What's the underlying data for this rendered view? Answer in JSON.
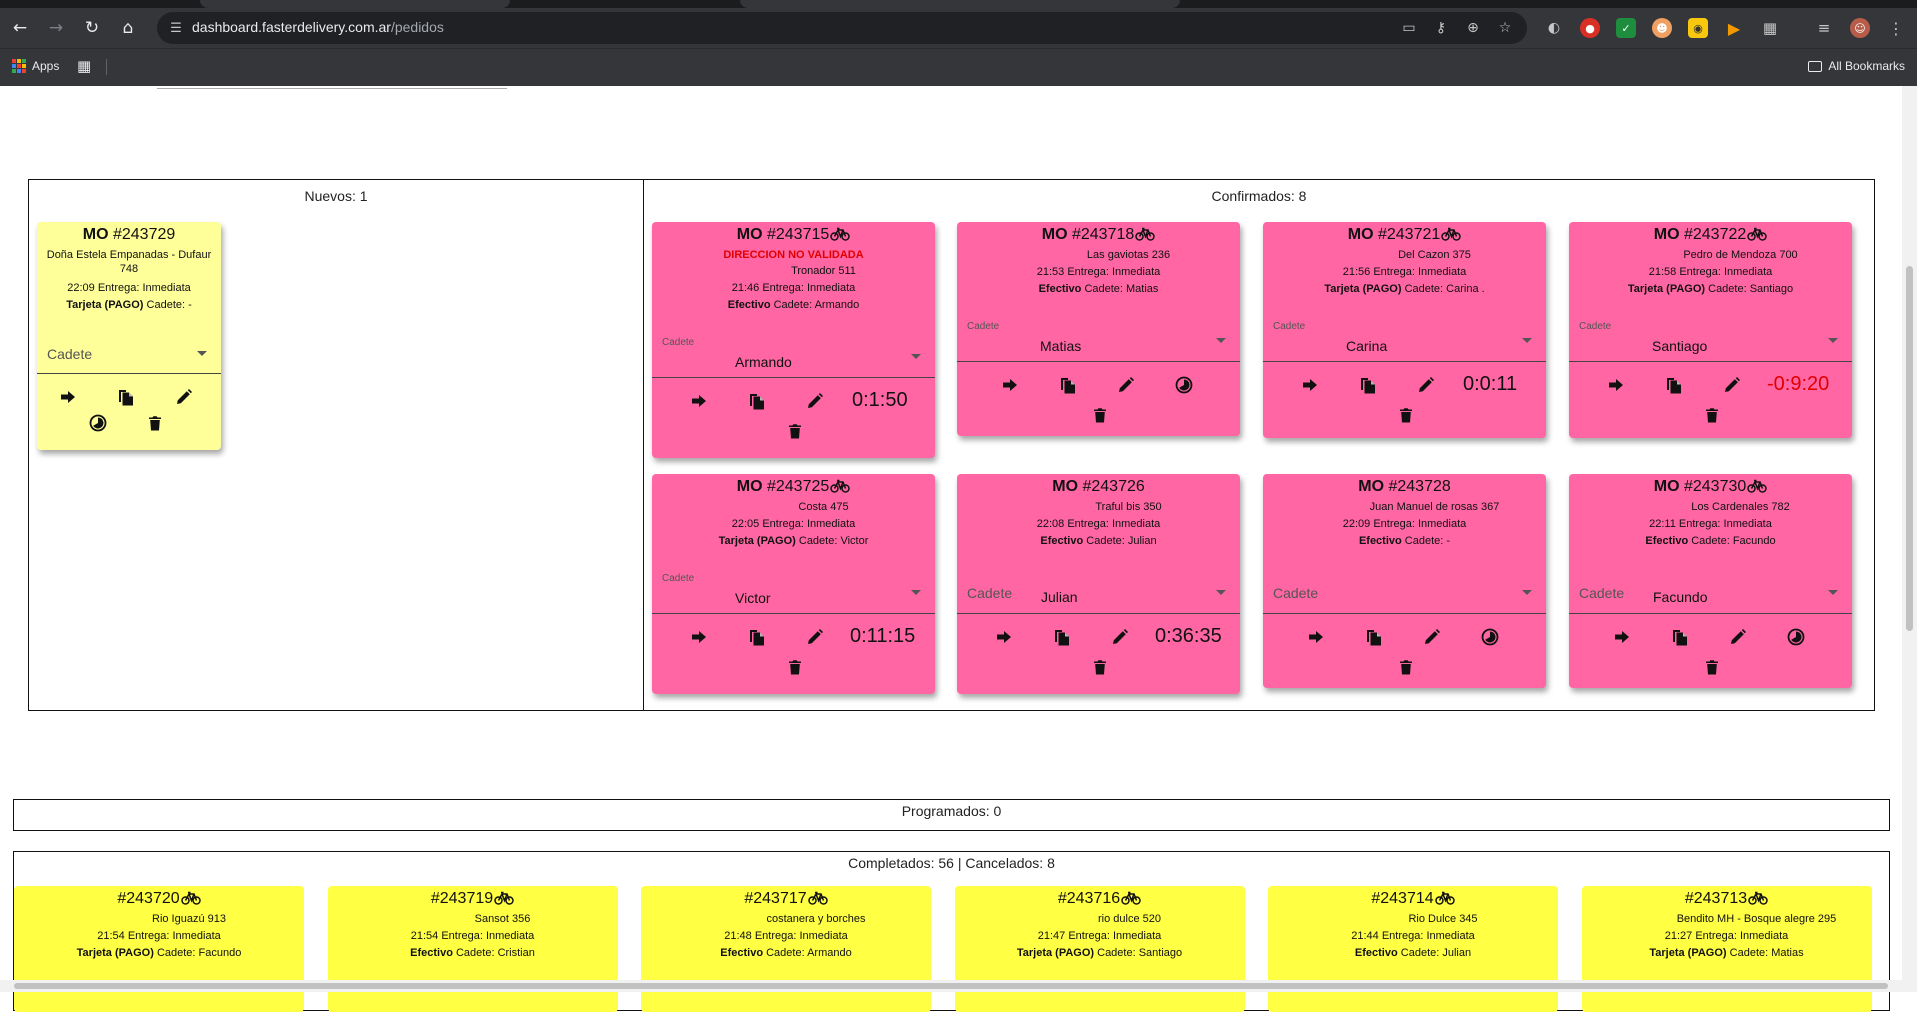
{
  "browser": {
    "url_domain": "dashboard.fasterdelivery.com.ar",
    "url_path": "/pedidos",
    "bookmarks": {
      "apps_label": "Apps",
      "all_bookmarks_label": "All Bookmarks"
    }
  },
  "colors": {
    "nuevo_card": "#ffff99",
    "confirmado_card": "#ff66a3",
    "completado_card": "#ffff44",
    "warning": "#e00000"
  },
  "icons": {
    "forward": "arrow-right-icon",
    "copy": "copy-icon",
    "edit": "pencil-icon",
    "schedule": "timer-icon",
    "delete": "trash-icon",
    "delivery": "bicycle-icon"
  },
  "nuevos": {
    "title": "Nuevos: 1",
    "cards": [
      {
        "prefix": "MO",
        "number": "#243729",
        "business": "Doña Estela Empanadas - Dufaur",
        "business2": "748",
        "time_line": "22:09 Entrega: Inmediata",
        "payment": "Tarjeta (PAGO)",
        "cadete_line": "Cadete: -",
        "select_placeholder": "Cadete"
      }
    ]
  },
  "confirmados": {
    "title": "Confirmados: 8",
    "cards": [
      {
        "prefix": "MO",
        "number": "#243715",
        "warning": "DIRECCION NO VALIDADA",
        "address": "Tronador 511",
        "time_line": "21:46 Entrega: Inmediata",
        "payment": "Efectivo",
        "cadete_line": "Cadete: Armando",
        "select_label": "Cadete",
        "select_value": "Armando",
        "timer": "0:1:50"
      },
      {
        "prefix": "MO",
        "number": "#243718",
        "address": "Las gaviotas 236",
        "time_line": "21:53 Entrega: Inmediata",
        "payment": "Efectivo",
        "cadete_line": "Cadete: Matias",
        "select_label": "Cadete",
        "select_value": "Matias",
        "timer": ""
      },
      {
        "prefix": "MO",
        "number": "#243721",
        "address": "Del Cazon 375",
        "time_line": "21:56 Entrega: Inmediata",
        "payment": "Tarjeta (PAGO)",
        "cadete_line": "Cadete: Carina .",
        "select_label": "Cadete",
        "select_value": "Carina",
        "timer": "0:0:11"
      },
      {
        "prefix": "MO",
        "number": "#243722",
        "address": "Pedro de Mendoza 700",
        "time_line": "21:58 Entrega: Inmediata",
        "payment": "Tarjeta (PAGO)",
        "cadete_line": "Cadete: Santiago",
        "select_label": "Cadete",
        "select_value": "Santiago",
        "timer": "-0:9:20"
      },
      {
        "prefix": "MO",
        "number": "#243725",
        "address": "Costa 475",
        "time_line": "22:05 Entrega: Inmediata",
        "payment": "Tarjeta (PAGO)",
        "cadete_line": "Cadete: Victor",
        "select_label": "Cadete",
        "select_value": "Victor",
        "timer": "0:11:15"
      },
      {
        "prefix": "MO",
        "number": "#243726",
        "address": "Traful bis 350",
        "time_line": "22:08 Entrega: Inmediata",
        "payment": "Efectivo",
        "cadete_line": "Cadete: Julian",
        "select_placeholder": "Cadete",
        "select_value": "Julian",
        "timer": "0:36:35"
      },
      {
        "prefix": "MO",
        "number": "#243728",
        "address": "Juan Manuel de rosas 367",
        "time_line": "22:09 Entrega: Inmediata",
        "payment": "Efectivo",
        "cadete_line": "Cadete: -",
        "select_placeholder": "Cadete",
        "timer": ""
      },
      {
        "prefix": "MO",
        "number": "#243730",
        "address": "Los Cardenales 782",
        "time_line": "22:11 Entrega: Inmediata",
        "payment": "Efectivo",
        "cadete_line": "Cadete: Facundo",
        "select_placeholder": "Cadete",
        "select_value": "Facundo",
        "timer": ""
      }
    ]
  },
  "programados": {
    "title": "Programados: 0"
  },
  "completados": {
    "title": "Completados: 56 | Cancelados: 8",
    "cards": [
      {
        "number": "#243720",
        "address": "Rio Iguazú 913",
        "time_line": "21:54 Entrega: Inmediata",
        "payment": "Tarjeta (PAGO)",
        "cadete_line": "Cadete: Facundo"
      },
      {
        "number": "#243719",
        "address": "Sansot 356",
        "time_line": "21:54 Entrega: Inmediata",
        "payment": "Efectivo",
        "cadete_line": "Cadete: Cristian"
      },
      {
        "number": "#243717",
        "address": "costanera y borches",
        "time_line": "21:48 Entrega: Inmediata",
        "payment": "Efectivo",
        "cadete_line": "Cadete: Armando"
      },
      {
        "number": "#243716",
        "address": "rio dulce 520",
        "time_line": "21:47 Entrega: Inmediata",
        "payment": "Tarjeta (PAGO)",
        "cadete_line": "Cadete: Santiago"
      },
      {
        "number": "#243714",
        "address": "Rio Dulce 345",
        "time_line": "21:44 Entrega: Inmediata",
        "payment": "Efectivo",
        "cadete_line": "Cadete: Julian"
      },
      {
        "number": "#243713",
        "address": "Bendito MH - Bosque alegre 295",
        "time_line": "21:27 Entrega: Inmediata",
        "payment": "Tarjeta (PAGO)",
        "cadete_line": "Cadete: Matias"
      }
    ]
  }
}
